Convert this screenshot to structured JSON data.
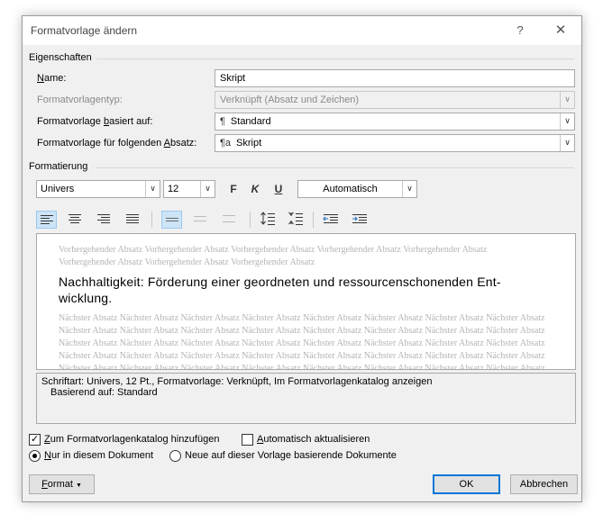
{
  "dialog": {
    "title": "Formatvorlage ändern",
    "help_icon": "?",
    "close_icon": "✕"
  },
  "properties": {
    "section_label": "Eigenschaften",
    "name_label": "Name:",
    "name_value": "Skript",
    "type_label": "Formatvorlagentyp:",
    "type_value": "Verknüpft (Absatz und Zeichen)",
    "based_on_label": "Formatvorlage basiert auf:",
    "based_on_icon": "¶",
    "based_on_value": "Standard",
    "next_label": "Formatvorlage für folgenden Absatz:",
    "next_icon": "¶a",
    "next_value": "Skript"
  },
  "formatting": {
    "section_label": "Formatierung",
    "font": "Univers",
    "size": "12",
    "bold": "F",
    "italic": "K",
    "underline": "U",
    "color": "Automatisch"
  },
  "preview": {
    "previous": "Vorhergehender Absatz Vorhergehender Absatz Vorhergehender Absatz Vorhergehender Absatz Vorhergehender Absatz Vorhergehender Absatz Vorhergehender Absatz Vorhergehender Absatz",
    "sample": "Nachhaltigkeit: Förderung einer geordneten und ressourcenschonenden Ent-wicklung.",
    "next": "Nächster Absatz Nächster Absatz Nächster Absatz Nächster Absatz Nächster Absatz Nächster Absatz Nächster Absatz Nächster Absatz Nächster Absatz Nächster Absatz Nächster Absatz Nächster Absatz Nächster Absatz Nächster Absatz Nächster Absatz Nächster Absatz Nächster Absatz Nächster Absatz Nächster Absatz Nächster Absatz Nächster Absatz Nächster Absatz Nächster Absatz Nächster Absatz Nächster Absatz Nächster Absatz Nächster Absatz Nächster Absatz Nächster Absatz Nächster Absatz Nächster Absatz Nächster Absatz Nächster Absatz Nächster Absatz Nächster Absatz Nächster Absatz Nächster Absatz Nächster Absatz Nächster Absatz Nächster Absatz"
  },
  "description": {
    "line1": "Schriftart: Univers, 12 Pt., Formatvorlage: Verknüpft, Im Formatvorlagenkatalog anzeigen",
    "line2": "Basierend auf: Standard"
  },
  "options": {
    "add_to_gallery": "Zum Formatvorlagenkatalog hinzufügen",
    "auto_update": "Automatisch aktualisieren",
    "only_this_doc": "Nur in diesem Dokument",
    "new_docs": "Neue auf dieser Vorlage basierende Dokumente"
  },
  "buttons": {
    "format": "Format",
    "ok": "OK",
    "cancel": "Abbrechen"
  }
}
